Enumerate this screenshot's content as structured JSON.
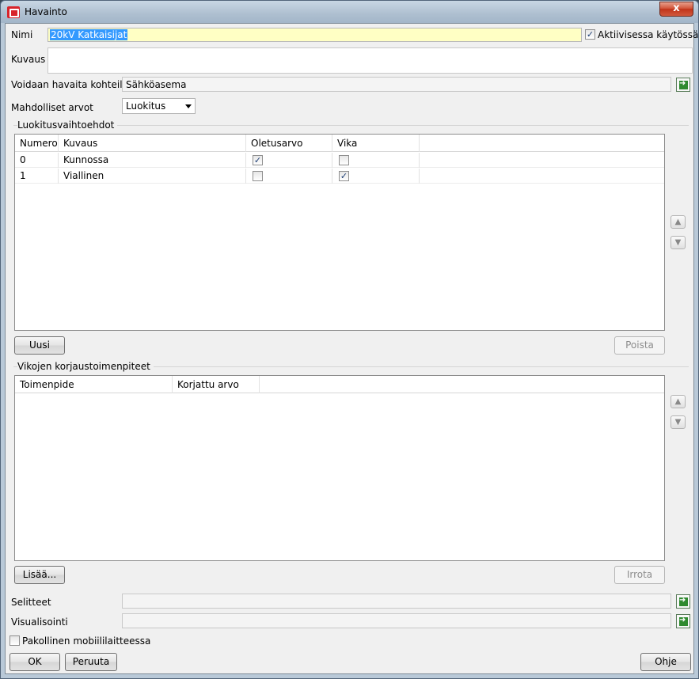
{
  "window": {
    "title": "Havainto",
    "close_glyph": "x"
  },
  "form": {
    "name_label": "Nimi",
    "name_value": "20kV Katkaisijat",
    "active_label": "Aktiivisessa käytössä",
    "active_checked": true,
    "description_label": "Kuvaus",
    "description_value": "",
    "targets_label": "Voidaan havaita kohteille",
    "targets_value": "Sähköasema",
    "values_label": "Mahdolliset arvot",
    "values_selected": "Luokitus"
  },
  "classification": {
    "title": "Luokitusvaihtoehdot",
    "columns": [
      "Numero",
      "Kuvaus",
      "Oletusarvo",
      "Vika"
    ],
    "rows": [
      {
        "numero": "0",
        "kuvaus": "Kunnossa",
        "oletusarvo": true,
        "vika": false
      },
      {
        "numero": "1",
        "kuvaus": "Viallinen",
        "oletusarvo": false,
        "vika": true
      }
    ],
    "new_label": "Uusi",
    "delete_label": "Poista"
  },
  "repairs": {
    "title": "Vikojen korjaustoimenpiteet",
    "columns": [
      "Toimenpide",
      "Korjattu arvo"
    ],
    "add_label": "Lisää...",
    "detach_label": "Irrota"
  },
  "footer": {
    "legends_label": "Selitteet",
    "visualization_label": "Visualisointi",
    "mandatory_label": "Pakollinen mobiililaitteessa",
    "mandatory_checked": false,
    "ok_label": "OK",
    "cancel_label": "Peruuta",
    "help_label": "Ohje"
  },
  "icons": {
    "app": "havainto-app-icon",
    "pick": "pick-arrow-icon",
    "up": "move-up-icon",
    "down": "move-down-icon"
  },
  "colors": {
    "title_bar": "#aebfd0",
    "close_button": "#c1341a",
    "name_field": "#ffffc4",
    "selection": "#3399ff"
  }
}
